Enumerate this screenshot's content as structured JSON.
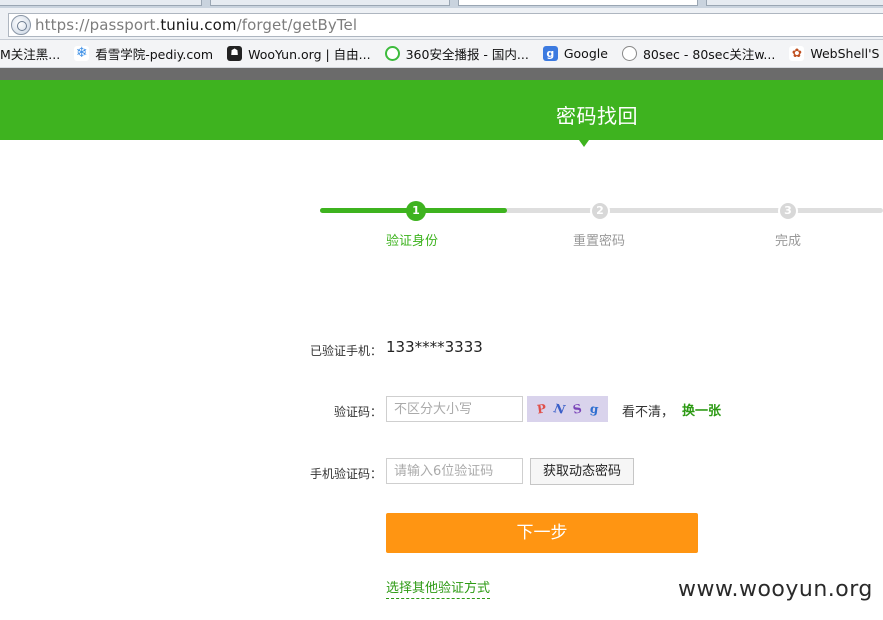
{
  "browser": {
    "url_prefix": "https://passport.",
    "url_domain": "tuniu.com",
    "url_path": "/forget/getByTel"
  },
  "bookmarks": [
    {
      "label": "M关注黑...",
      "icon": "folder-icon"
    },
    {
      "label": "看雪学院-pediy.com",
      "icon": "snowflake-icon"
    },
    {
      "label": "WooYun.org | 自由...",
      "icon": "wooyun-icon"
    },
    {
      "label": "360安全播报 - 国内...",
      "icon": "360-icon"
    },
    {
      "label": "Google",
      "icon": "google-icon"
    },
    {
      "label": "80sec - 80sec关注w...",
      "icon": "page-icon"
    },
    {
      "label": "WebShell'S Blog",
      "icon": "webshell-icon"
    }
  ],
  "header": {
    "title": "密码找回",
    "background_color": "#3eb31f"
  },
  "steps": [
    {
      "number": "1",
      "label": "验证身份",
      "state": "active"
    },
    {
      "number": "2",
      "label": "重置密码",
      "state": "pending"
    },
    {
      "number": "3",
      "label": "完成",
      "state": "pending"
    }
  ],
  "progress": {
    "current_step": 1,
    "total_steps": 3
  },
  "form": {
    "phone_label": "已验证手机：",
    "phone_value": "133****3333",
    "captcha_label": "验证码：",
    "captcha_placeholder": "不区分大小写",
    "captcha_chars": [
      "P",
      "N",
      "S",
      "g"
    ],
    "unclear_text": "看不清，",
    "refresh_link": "换一张",
    "sms_label": "手机验证码：",
    "sms_placeholder": "请输入6位验证码",
    "get_code_button": "获取动态密码",
    "next_button": "下一步",
    "other_method_link": "选择其他验证方式"
  },
  "colors": {
    "accent_green": "#3eb31f",
    "button_orange": "#ff9512"
  },
  "watermark": "www.wooyun.org"
}
